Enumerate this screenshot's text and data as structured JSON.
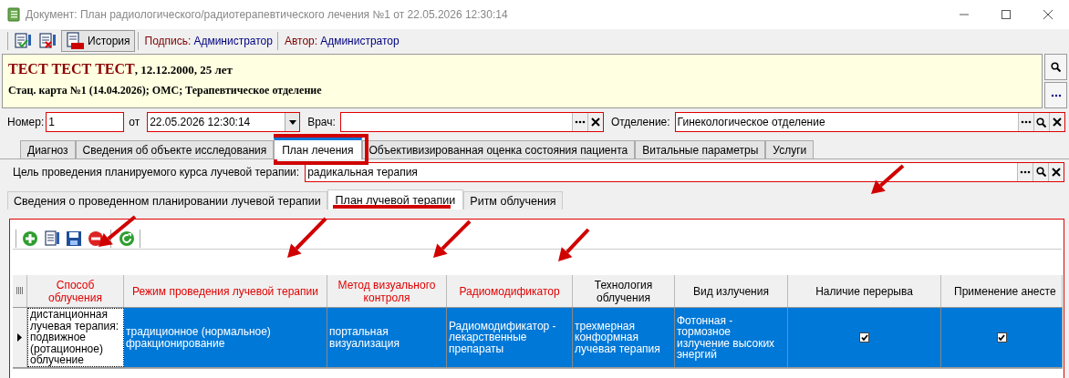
{
  "window": {
    "title": "Документ: План радиологического/радиотерапевтического лечения №1 от 22.05.2026 12:30:14"
  },
  "toolbar": {
    "buttons": [
      {
        "kind": "sign"
      },
      {
        "kind": "unsign"
      },
      {
        "kind": "history",
        "label": "История"
      }
    ],
    "signature": {
      "label": "Подпись:",
      "value": "Администратор"
    },
    "author": {
      "label": "Автор:",
      "value": "Администратор"
    }
  },
  "patient": {
    "name": "ТЕСТ ТЕСТ ТЕСТ",
    "details": ", 12.12.2000, 25 лет",
    "card": "Стац. карта №1 (14.04.2026); ОМС; Терапевтическое отделение"
  },
  "header_fields": {
    "number": {
      "label": "Номер:",
      "value": "1"
    },
    "date": {
      "label": "от",
      "value": "22.05.2026 12:30:14"
    },
    "doctor": {
      "label": "Врач:"
    },
    "department": {
      "label": "Отделение:",
      "value": "Гинекологическое отделение"
    }
  },
  "tabs": [
    {
      "label": "Диагноз",
      "selected": false
    },
    {
      "label": "Сведения об объекте исследования",
      "selected": false
    },
    {
      "label": "План лечения",
      "selected": true
    },
    {
      "label": "Объективизированная оценка состояния пациента",
      "selected": false
    },
    {
      "label": "Витальные параметры",
      "selected": false
    },
    {
      "label": "Услуги",
      "selected": false
    }
  ],
  "goal": {
    "label": "Цель проведения планируемого курса лучевой терапии:",
    "value": "радикальная терапия"
  },
  "subtabs": [
    {
      "label": "Сведения о проведенном планировании лучевой терапии",
      "selected": false
    },
    {
      "label": "План лучевой терапии",
      "selected": true
    },
    {
      "label": "Ритм облучения",
      "selected": false
    }
  ],
  "grid": {
    "tools": [
      {
        "kind": "add"
      },
      {
        "kind": "edit"
      },
      {
        "kind": "save"
      },
      {
        "kind": "delete"
      },
      {
        "kind": "refresh"
      }
    ],
    "columns": [
      {
        "label": "Способ облучения",
        "required": true
      },
      {
        "label": "Режим проведения лучевой терапии",
        "required": true
      },
      {
        "label": "Метод визуального контроля",
        "required": true
      },
      {
        "label": "Радиомодификатор",
        "required": true
      },
      {
        "label": "Технология облучения",
        "required": false
      },
      {
        "label": "Вид излучения",
        "required": false
      },
      {
        "label": "Наличие перерыва",
        "required": false
      },
      {
        "label": "Применение анесте",
        "required": false
      }
    ],
    "rows": [
      {
        "selected": true,
        "cells": [
          {
            "kind": "text",
            "value": "дистанционная лучевая терапия: подвижное (ротационное) облучение",
            "focused": true
          },
          {
            "kind": "text",
            "value": "традиционное (нормальное) фракционирование",
            "focused": false
          },
          {
            "kind": "text",
            "value": "портальная визуализация",
            "focused": false
          },
          {
            "kind": "text",
            "value": "Радиомодификатор - лекарственные препараты",
            "focused": false
          },
          {
            "kind": "text",
            "value": "трехмерная конформная лучевая терапия",
            "focused": false
          },
          {
            "kind": "text",
            "value": "Фотонная - тормозное излучение высоких энергий",
            "focused": false
          },
          {
            "kind": "check",
            "checked": true
          },
          {
            "kind": "check",
            "checked": true
          }
        ]
      }
    ]
  }
}
